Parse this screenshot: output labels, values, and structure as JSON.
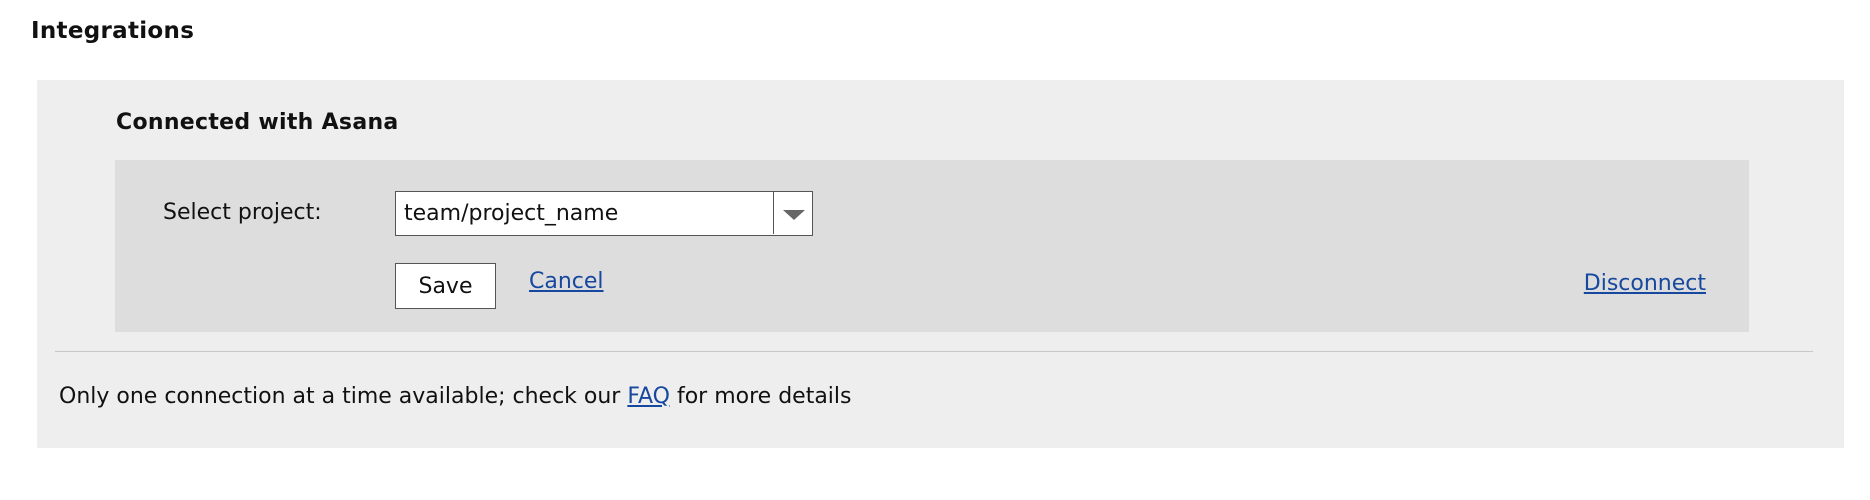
{
  "page": {
    "title": "Integrations"
  },
  "connection": {
    "heading": "Connected with Asana",
    "select_label": "Select project:",
    "selected_project": "team/project_name",
    "dropdown_icon": "chevron-down-icon",
    "save_label": "Save",
    "cancel_label": "Cancel",
    "disconnect_label": "Disconnect"
  },
  "footer": {
    "text_before": "Only one connection at a time available; check our ",
    "faq_link": "FAQ",
    "text_after": " for more details"
  },
  "colors": {
    "link": "#15489e",
    "outer_panel": "#eeeeee",
    "inner_panel": "#dddddd"
  }
}
